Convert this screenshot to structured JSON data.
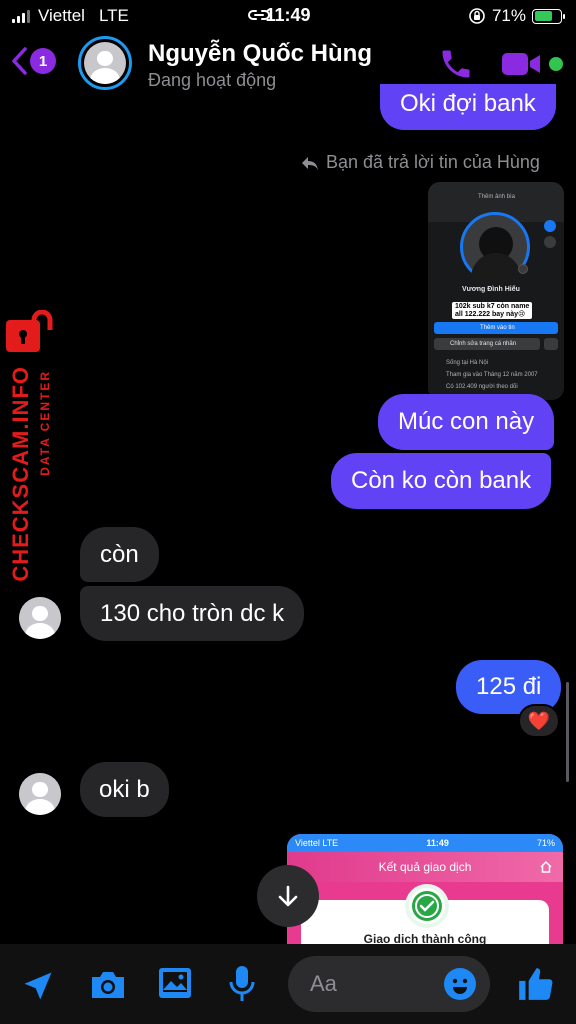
{
  "status": {
    "carrier": "Viettel",
    "network": "LTE",
    "time": "11:49",
    "battery": "71%"
  },
  "header": {
    "unread_count": "1",
    "contact_name": "Nguyễn Quốc Hùng",
    "contact_status": "Đang hoạt động"
  },
  "messages": {
    "m1": "Oki đợi bank",
    "reply_note": "Bạn đã trả lời tin của Hùng",
    "m2": "Múc con này",
    "m3": "Còn ko còn bank",
    "m4": "còn",
    "m5": "130 cho tròn dc k",
    "m6": "125 đi",
    "m6_reaction": "❤️",
    "m7": "oki b"
  },
  "profile_shot": {
    "cover_label": "Thêm ảnh bìa",
    "name": "Vương Đình Hiếu",
    "caption_line1": "102k sub k7 còn name",
    "caption_line2": "all 122.222 bay này😢",
    "btn_story": "Thêm vào tin",
    "btn_edit": "Chỉnh sửa trang cá nhân",
    "info1": "Sống tại Hà Nội",
    "info2": "Tham gia vào Tháng 12 năm 2007",
    "info3": "Có 102.409 người theo dõi"
  },
  "txn_shot": {
    "carrier": "Viettel  LTE",
    "time": "11:49",
    "battery": "71%",
    "title": "Kết quả giao dịch",
    "result": "Giao dịch thành công"
  },
  "composer": {
    "placeholder": "Aa"
  },
  "watermark": {
    "brand": "CHECKSCAM.INFO",
    "sub": "DATA CENTER"
  },
  "colors": {
    "outgoing": "#6142f5",
    "incoming": "#262628",
    "accent": "#8a2be2",
    "icon_blue": "#1e88f5"
  }
}
